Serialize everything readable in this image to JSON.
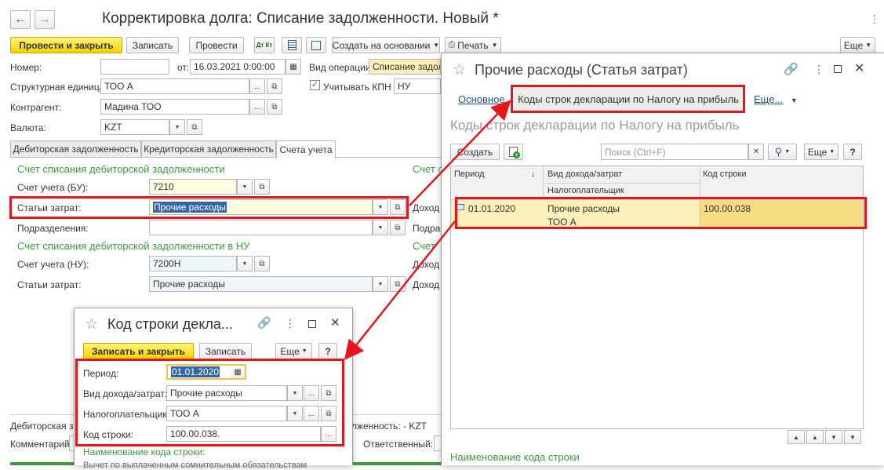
{
  "main": {
    "title": "Корректировка долга: Списание задолженности. Новый *",
    "toolbar": {
      "post_close": "Провести и закрыть",
      "save": "Записать",
      "post": "Провести",
      "dtkt": "Дт Кт",
      "create_based": "Создать на основании",
      "print": "Печать",
      "more": "Еще"
    },
    "fields": {
      "number_label": "Номер:",
      "from_label": "от:",
      "date_value": "16.03.2021  0:00:00",
      "operation_label": "Вид операции:",
      "operation_value": "Списание задолженности",
      "unit_label": "Структурная единица:",
      "unit_value": "ТОО А",
      "kpn_label": "Учитывать КПН",
      "kpn_value": "НУ",
      "contractor_label": "Контрагент:",
      "contractor_value": "Мадина ТОО",
      "currency_label": "Валюта:",
      "currency_value": "KZT"
    },
    "tabs": [
      "Дебиторская задолженность",
      "Кредиторская задолженность",
      "Счета учета"
    ],
    "sec1_title": "Счет списания дебиторской задолженности",
    "sec1_right": "Счет с",
    "account_bu_label": "Счет учета (БУ):",
    "account_bu_value": "7210",
    "expense_label": "Статьи затрат:",
    "expense_value": "Прочие расходы",
    "right_income_1": "Доход",
    "dept_label": "Подразделения:",
    "right_income_2": "Подра",
    "sec2_title": "Счет списания дебиторской задолженности в НУ",
    "sec2_right": "Счет",
    "account_nu_label": "Счет учета (НУ):",
    "account_nu_value": "7200Н",
    "right_income_3": "Доход",
    "expense2_label": "Статьи затрат:",
    "expense2_value": "Прочие расходы",
    "right_income_4": "Доход",
    "bottom_receivable": "Дебиторская зад",
    "bottom_right": "лженность: - KZT",
    "comment_label": "Комментарий:",
    "responsible_label": "Ответственный:"
  },
  "expenses_win": {
    "title": "Прочие расходы (Статья затрат)",
    "tab_main": "Основное",
    "tab_codes": "Коды строк декларации по Налогу на прибыль",
    "tab_more": "Еще...",
    "subtitle": "Коды строк декларации по Налогу на прибыль",
    "create": "Создать",
    "search_placeholder": "Поиск (Ctrl+F)",
    "more": "Еще",
    "help": "?",
    "columns": {
      "period": "Период",
      "kind": "Вид дохода/затрат",
      "taxpayer": "Налогоплательщик",
      "code": "Код строки"
    },
    "rows": [
      {
        "period": "01.01.2020",
        "kind": "Прочие расходы",
        "taxpayer": "ТОО А",
        "code": "100.00.038"
      }
    ],
    "footer": "Наименование кода строки"
  },
  "code_win": {
    "title": "Код строки декла...",
    "save_close": "Записать и закрыть",
    "save": "Записать",
    "more": "Еще",
    "help": "?",
    "period_label": "Период:",
    "period_value": "01.01.2020",
    "kind_label": "Вид дохода/затрат:",
    "kind_value": "Прочие расходы",
    "taxpayer_label": "Налогоплательщик:",
    "taxpayer_value": "ТОО А",
    "code_label": "Код строки:",
    "code_value": "100.00.038.",
    "name_label": "Наименование кода строки:",
    "name_value": "Вычет по выплаченным сомнительным обязательствам"
  },
  "colors": {
    "accent_yellow": "#f5d400",
    "highlight_red": "#e8141c",
    "section_green": "#3d9a3d",
    "row_highlight": "#fbf0b9"
  }
}
